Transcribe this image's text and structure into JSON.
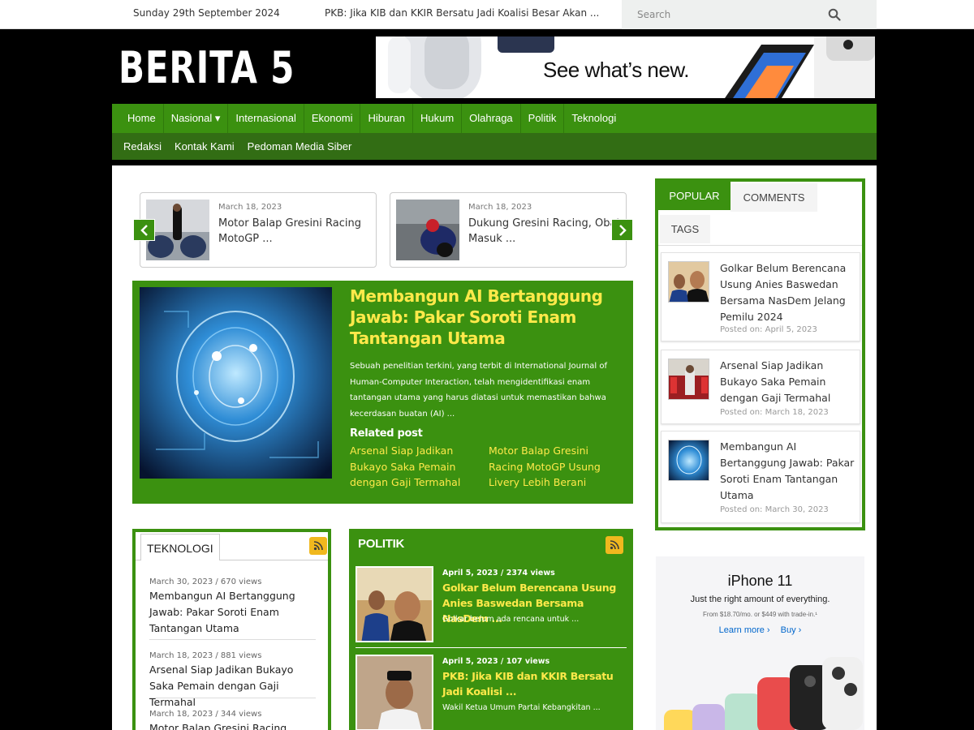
{
  "topbar": {
    "date": "Sunday 29th September 2024",
    "ticker": "PKB: Jika KIB dan KKIR Bersatu Jadi Koalisi Besar Akan ...",
    "search_placeholder": "Search",
    "search_icon": "search-icon"
  },
  "header": {
    "logo": "BERITA 5",
    "banner_headline": "See what’s new."
  },
  "nav": {
    "primary": [
      {
        "label": "Home"
      },
      {
        "label": "Nasional ▾"
      },
      {
        "label": "Internasional"
      },
      {
        "label": "Ekonomi"
      },
      {
        "label": "Hiburan"
      },
      {
        "label": "Hukum"
      },
      {
        "label": "Olahraga"
      },
      {
        "label": "Politik"
      },
      {
        "label": "Teknologi"
      }
    ],
    "secondary": [
      {
        "label": "Redaksi"
      },
      {
        "label": "Kontak Kami"
      },
      {
        "label": "Pedoman Media Siber"
      }
    ]
  },
  "slider": {
    "items": [
      {
        "date": "March 18, 2023",
        "title": "Motor Balap Gresini Racing MotoGP ..."
      },
      {
        "date": "March 18, 2023",
        "title": "Dukung Gresini Racing, Obat Masuk ..."
      }
    ]
  },
  "feature": {
    "title": "Membangun AI Bertanggung Jawab: Pakar Soroti Enam Tantangan Utama",
    "excerpt": "Sebuah penelitian terkini, yang terbit di International Journal of Human-Computer Interaction, telah mengidentifikasi enam tantangan utama yang harus diatasi untuk memastikan bahwa kecerdasan buatan (AI) ...",
    "related_heading": "Related post",
    "related": [
      "Arsenal Siap Jadikan Bukayo Saka Pemain dengan Gaji Termahal",
      "Motor Balap Gresini Racing MotoGP Usung Livery Lebih Berani"
    ]
  },
  "teknologi": {
    "heading": "TEKNOLOGI",
    "items": [
      {
        "meta": "March 30, 2023 / 670 views",
        "title": "Membangun AI Bertanggung Jawab: Pakar Soroti Enam Tantangan Utama"
      },
      {
        "meta": "March 18, 2023 / 881 views",
        "title": "Arsenal Siap Jadikan Bukayo Saka Pemain dengan Gaji Termahal"
      },
      {
        "meta": "March 18, 2023 / 344 views",
        "title": "Motor Balap Gresini Racing"
      }
    ]
  },
  "politik": {
    "heading": "POLITIK",
    "items": [
      {
        "meta": "April 5, 2023 / 2374 views",
        "title": "Golkar Belum Berencana Usung Anies Baswedan Bersama NasDem ...",
        "excerpt": "Golkar belum ada rencana untuk ..."
      },
      {
        "meta": "April 5, 2023 / 107 views",
        "title": "PKB: Jika KIB dan KKIR Bersatu Jadi Koalisi ...",
        "excerpt": "Wakil Ketua Umum Partai Kebangkitan ..."
      }
    ]
  },
  "sidebar": {
    "tabs": [
      {
        "label": "POPULAR",
        "active": true
      },
      {
        "label": "COMMENTS",
        "active": false
      },
      {
        "label": "TAGS",
        "active": false
      }
    ],
    "popular": [
      {
        "title": "Golkar Belum Berencana Usung Anies Baswedan Bersama NasDem Jelang Pemilu 2024",
        "posted": "Posted on: April 5, 2023"
      },
      {
        "title": "Arsenal Siap Jadikan Bukayo Saka Pemain dengan Gaji Termahal",
        "posted": "Posted on: March 18, 2023"
      },
      {
        "title": "Membangun AI Bertanggung Jawab: Pakar Soroti Enam Tantangan Utama",
        "posted": "Posted on: March 30, 2023"
      }
    ]
  },
  "sidebar_ad": {
    "heading": "iPhone 11",
    "subheading": "Just the right amount of everything.",
    "price": "From $18.70/mo. or $449 with trade-in.¹",
    "learn_more": "Learn more ›",
    "buy": "Buy ›"
  },
  "colors": {
    "brand_green": "#3b9110",
    "dark_green": "#326d14",
    "headline_yellow": "#ffe94a",
    "rss_orange": "#f0b81e"
  }
}
